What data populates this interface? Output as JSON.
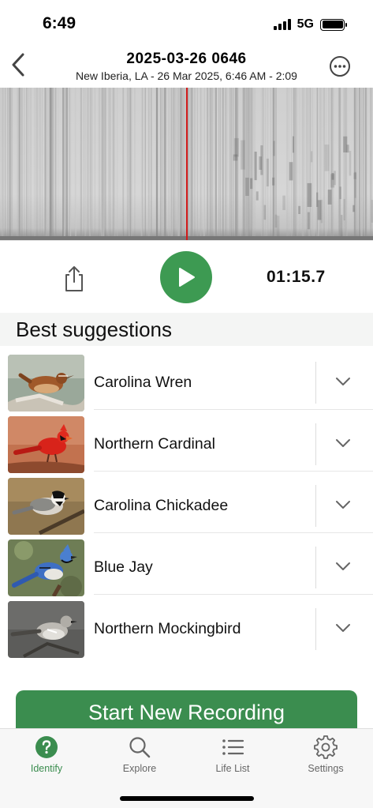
{
  "status_bar": {
    "time": "6:49",
    "network": "5G"
  },
  "header": {
    "title": "2025-03-26 0646",
    "subtitle": "New Iberia, LA - 26 Mar 2025, 6:46 AM - 2:09",
    "back_icon": "chevron-left-icon",
    "more_icon": "ellipsis-circle-icon"
  },
  "player": {
    "elapsed": "01:15.7",
    "play_icon": "play-icon",
    "share_icon": "share-icon",
    "accent_color": "#3d9a52",
    "playhead_color": "#d11a1a"
  },
  "suggestions": {
    "heading": "Best suggestions",
    "items": [
      {
        "name": "Carolina Wren"
      },
      {
        "name": "Northern Cardinal"
      },
      {
        "name": "Carolina Chickadee"
      },
      {
        "name": "Blue Jay"
      },
      {
        "name": "Northern Mockingbird"
      }
    ]
  },
  "start_button": {
    "label": "Start New Recording",
    "color": "#3b8d4f"
  },
  "tabs": [
    {
      "label": "Identify",
      "icon": "question-circle-icon",
      "active": true
    },
    {
      "label": "Explore",
      "icon": "search-icon",
      "active": false
    },
    {
      "label": "Life List",
      "icon": "list-icon",
      "active": false
    },
    {
      "label": "Settings",
      "icon": "gear-icon",
      "active": false
    }
  ]
}
